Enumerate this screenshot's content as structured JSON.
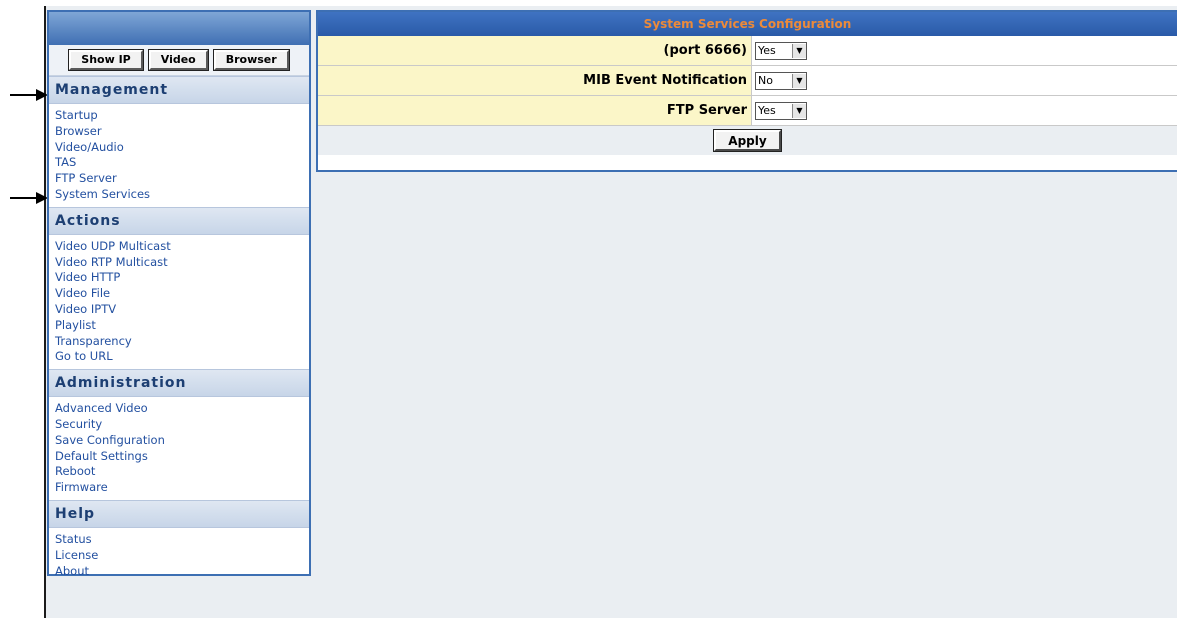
{
  "sidebar": {
    "buttons": {
      "show_ip": "Show IP",
      "video": "Video",
      "browser": "Browser"
    },
    "sections": [
      {
        "title": "Management",
        "items": [
          "Startup",
          "Browser",
          "Video/Audio",
          "TAS",
          "FTP Server",
          "System Services"
        ]
      },
      {
        "title": "Actions",
        "items": [
          "Video UDP Multicast",
          "Video RTP Multicast",
          "Video HTTP",
          "Video File",
          "Video IPTV",
          "Playlist",
          "Transparency",
          "Go to URL"
        ]
      },
      {
        "title": "Administration",
        "items": [
          "Advanced Video",
          "Security",
          "Save Configuration",
          "Default Settings",
          "Reboot",
          "Firmware"
        ]
      },
      {
        "title": "Help",
        "items": [
          "Status",
          "License",
          "About"
        ]
      }
    ]
  },
  "main": {
    "title": "System Services Configuration",
    "rows": [
      {
        "label": "(port 6666)",
        "value": "Yes"
      },
      {
        "label": "MIB Event Notification",
        "value": "No"
      },
      {
        "label": "FTP Server",
        "value": "Yes"
      }
    ],
    "apply_label": "Apply"
  },
  "icons": {
    "arrow": "right-arrow-icon",
    "dropdown": "dropdown-arrow-icon"
  },
  "colors": {
    "header_blue": "#2a5aa8",
    "title_text": "#ec8a3a",
    "label_bg": "#fbf6c8",
    "link": "#2350a0"
  }
}
